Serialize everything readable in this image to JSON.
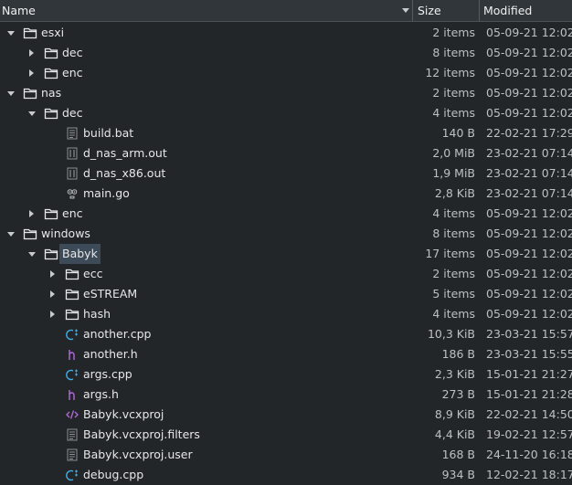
{
  "header": {
    "name": "Name",
    "size": "Size",
    "modified": "Modified"
  },
  "rows": [
    {
      "depth": 0,
      "expander": "down",
      "icon": "folder",
      "name": "esxi",
      "size": "2 items",
      "modified": "05-09-21 12:02"
    },
    {
      "depth": 1,
      "expander": "right",
      "icon": "folder",
      "name": "dec",
      "size": "8 items",
      "modified": "05-09-21 12:02"
    },
    {
      "depth": 1,
      "expander": "right",
      "icon": "folder",
      "name": "enc",
      "size": "12 items",
      "modified": "05-09-21 12:02"
    },
    {
      "depth": 0,
      "expander": "down",
      "icon": "folder",
      "name": "nas",
      "size": "2 items",
      "modified": "05-09-21 12:02"
    },
    {
      "depth": 1,
      "expander": "down",
      "icon": "folder",
      "name": "dec",
      "size": "4 items",
      "modified": "05-09-21 12:02"
    },
    {
      "depth": 2,
      "expander": "none",
      "icon": "text",
      "name": "build.bat",
      "size": "140 B",
      "modified": "22-02-21 17:29"
    },
    {
      "depth": 2,
      "expander": "none",
      "icon": "binary",
      "name": "d_nas_arm.out",
      "size": "2,0 MiB",
      "modified": "23-02-21 07:14"
    },
    {
      "depth": 2,
      "expander": "none",
      "icon": "binary",
      "name": "d_nas_x86.out",
      "size": "1,9 MiB",
      "modified": "23-02-21 07:14"
    },
    {
      "depth": 2,
      "expander": "none",
      "icon": "go",
      "name": "main.go",
      "size": "2,8 KiB",
      "modified": "23-02-21 07:14"
    },
    {
      "depth": 1,
      "expander": "right",
      "icon": "folder",
      "name": "enc",
      "size": "4 items",
      "modified": "05-09-21 12:02"
    },
    {
      "depth": 0,
      "expander": "down",
      "icon": "folder",
      "name": "windows",
      "size": "8 items",
      "modified": "05-09-21 12:02"
    },
    {
      "depth": 1,
      "expander": "down",
      "icon": "folder",
      "name": "Babyk",
      "size": "17 items",
      "modified": "05-09-21 12:02",
      "highlight": true
    },
    {
      "depth": 2,
      "expander": "right",
      "icon": "folder",
      "name": "ecc",
      "size": "2 items",
      "modified": "05-09-21 12:02"
    },
    {
      "depth": 2,
      "expander": "right",
      "icon": "folder",
      "name": "eSTREAM",
      "size": "5 items",
      "modified": "05-09-21 12:02"
    },
    {
      "depth": 2,
      "expander": "right",
      "icon": "folder",
      "name": "hash",
      "size": "4 items",
      "modified": "05-09-21 12:02"
    },
    {
      "depth": 2,
      "expander": "none",
      "icon": "cpp",
      "name": "another.cpp",
      "size": "10,3 KiB",
      "modified": "23-03-21 15:57"
    },
    {
      "depth": 2,
      "expander": "none",
      "icon": "header",
      "name": "another.h",
      "size": "186 B",
      "modified": "23-03-21 15:55"
    },
    {
      "depth": 2,
      "expander": "none",
      "icon": "cpp",
      "name": "args.cpp",
      "size": "2,3 KiB",
      "modified": "15-01-21 21:27"
    },
    {
      "depth": 2,
      "expander": "none",
      "icon": "header",
      "name": "args.h",
      "size": "273 B",
      "modified": "15-01-21 21:28"
    },
    {
      "depth": 2,
      "expander": "none",
      "icon": "xml",
      "name": "Babyk.vcxproj",
      "size": "8,9 KiB",
      "modified": "22-02-21 14:50"
    },
    {
      "depth": 2,
      "expander": "none",
      "icon": "text",
      "name": "Babyk.vcxproj.filters",
      "size": "4,4 KiB",
      "modified": "19-02-21 12:57"
    },
    {
      "depth": 2,
      "expander": "none",
      "icon": "text",
      "name": "Babyk.vcxproj.user",
      "size": "168 B",
      "modified": "24-11-20 16:18"
    },
    {
      "depth": 2,
      "expander": "none",
      "icon": "cpp",
      "name": "debug.cpp",
      "size": "934 B",
      "modified": "12-02-21 18:17"
    }
  ],
  "colors": {
    "background": "#232629",
    "header": "#31363b",
    "highlight": "#3d4a57",
    "cpp_icon": "#3daee9",
    "header_icon": "#b16bd6"
  }
}
